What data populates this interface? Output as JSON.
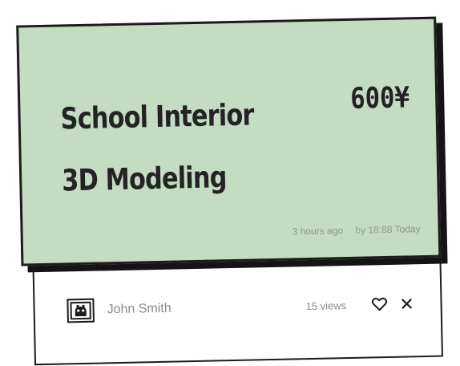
{
  "listing": {
    "title": "School Interior\n3D Modeling",
    "price": "600¥",
    "posted": "3 hours ago",
    "deadline": "by 18:88 Today"
  },
  "author": {
    "name": "John Smith",
    "avatar_icon": "avatar-icon"
  },
  "stats": {
    "views": "15 views"
  },
  "icons": {
    "like": "heart-icon",
    "close": "close-icon"
  },
  "colors": {
    "card_background": "#c4dcc2",
    "border": "#1c1c1c",
    "muted_text": "#8c8c8c"
  }
}
